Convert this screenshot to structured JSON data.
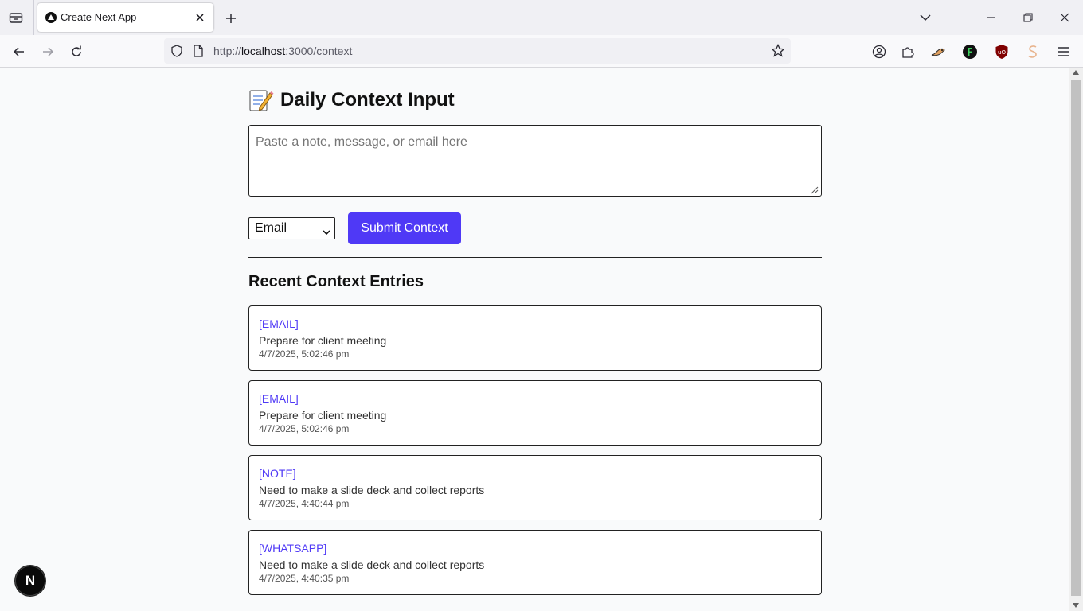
{
  "browser": {
    "tab_title": "Create Next App",
    "url_prefix": "http://",
    "url_host": "localhost",
    "url_path": ":3000/context"
  },
  "page": {
    "heading": "Daily Context Input",
    "heading_emoji": "memo-icon",
    "textarea_placeholder": "Paste a note, message, or email here",
    "textarea_value": "",
    "select_value": "Email",
    "submit_label": "Submit Context",
    "section_title": "Recent Context Entries",
    "accent_color": "#4f39f6",
    "entries": [
      {
        "type": "[EMAIL]",
        "text": "Prepare for client meeting",
        "time": "4/7/2025, 5:02:46 pm"
      },
      {
        "type": "[EMAIL]",
        "text": "Prepare for client meeting",
        "time": "4/7/2025, 5:02:46 pm"
      },
      {
        "type": "[NOTE]",
        "text": "Need to make a slide deck and collect reports",
        "time": "4/7/2025, 4:40:44 pm"
      },
      {
        "type": "[WHATSAPP]",
        "text": "Need to make a slide deck and collect reports",
        "time": "4/7/2025, 4:40:35 pm"
      }
    ],
    "next_badge": "N"
  }
}
